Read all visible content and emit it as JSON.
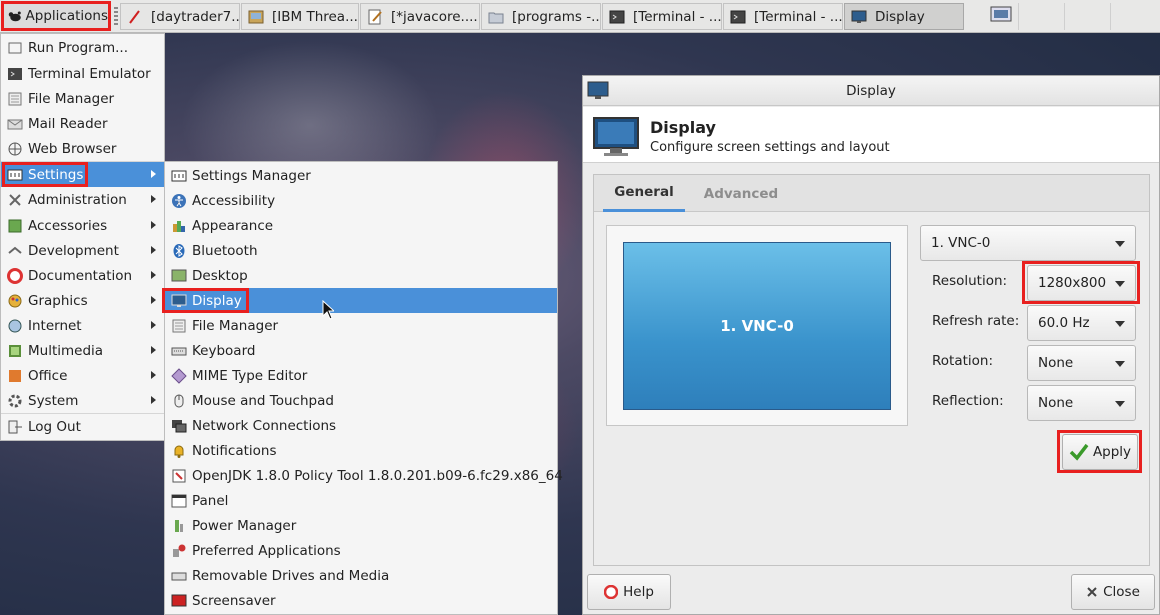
{
  "panel": {
    "app_menu_label": "Applications",
    "tasks": [
      {
        "label": "[daytrader7...",
        "icon": "pen-icon"
      },
      {
        "label": "[IBM Threa...",
        "icon": "java-app-icon"
      },
      {
        "label": "[*javacore....",
        "icon": "text-editor-icon"
      },
      {
        "label": "[programs -...",
        "icon": "folder-icon"
      },
      {
        "label": "[Terminal - ...",
        "icon": "terminal-icon"
      },
      {
        "label": "[Terminal - ...",
        "icon": "terminal-icon"
      },
      {
        "label": "Display",
        "icon": "display-icon"
      }
    ]
  },
  "apps_menu": {
    "items": [
      {
        "label": "Run Program...",
        "icon": "run-icon"
      },
      {
        "label": "Terminal Emulator",
        "icon": "terminal-icon"
      },
      {
        "label": "File Manager",
        "icon": "file-manager-icon"
      },
      {
        "label": "Mail Reader",
        "icon": "mail-icon"
      },
      {
        "label": "Web Browser",
        "icon": "globe-icon"
      },
      {
        "label": "Settings",
        "icon": "settings-icon"
      },
      {
        "label": "Administration",
        "icon": "tools-icon"
      },
      {
        "label": "Accessories",
        "icon": "accessories-icon"
      },
      {
        "label": "Development",
        "icon": "development-icon"
      },
      {
        "label": "Documentation",
        "icon": "help-icon"
      },
      {
        "label": "Graphics",
        "icon": "graphics-icon"
      },
      {
        "label": "Internet",
        "icon": "globe-icon"
      },
      {
        "label": "Multimedia",
        "icon": "multimedia-icon"
      },
      {
        "label": "Office",
        "icon": "office-icon"
      },
      {
        "label": "System",
        "icon": "gear-icon"
      },
      {
        "label": "Log Out",
        "icon": "logout-icon"
      }
    ]
  },
  "settings_menu": {
    "items": [
      {
        "label": "Settings Manager",
        "icon": "settings-manager-icon"
      },
      {
        "label": "Accessibility",
        "icon": "accessibility-icon"
      },
      {
        "label": "Appearance",
        "icon": "appearance-icon"
      },
      {
        "label": "Bluetooth",
        "icon": "bluetooth-icon"
      },
      {
        "label": "Desktop",
        "icon": "desktop-icon"
      },
      {
        "label": "Display",
        "icon": "display-icon"
      },
      {
        "label": "File Manager",
        "icon": "file-manager-icon"
      },
      {
        "label": "Keyboard",
        "icon": "keyboard-icon"
      },
      {
        "label": "MIME Type Editor",
        "icon": "mime-icon"
      },
      {
        "label": "Mouse and Touchpad",
        "icon": "mouse-icon"
      },
      {
        "label": "Network Connections",
        "icon": "network-icon"
      },
      {
        "label": "Notifications",
        "icon": "bell-icon"
      },
      {
        "label": "OpenJDK 1.8.0 Policy Tool 1.8.0.201.b09-6.fc29.x86_64",
        "icon": "java-icon"
      },
      {
        "label": "Panel",
        "icon": "panel-icon"
      },
      {
        "label": "Power Manager",
        "icon": "power-icon"
      },
      {
        "label": "Preferred Applications",
        "icon": "preferred-apps-icon"
      },
      {
        "label": "Removable Drives and Media",
        "icon": "drive-icon"
      },
      {
        "label": "Screensaver",
        "icon": "screensaver-icon"
      }
    ]
  },
  "dialog": {
    "window_title": "Display",
    "header_title": "Display",
    "header_subtitle": "Configure screen settings and layout",
    "tabs": [
      "General",
      "Advanced"
    ],
    "monitor_label": "1. VNC-0",
    "display_select": "1. VNC-0",
    "resolution_label": "Resolution:",
    "resolution_value": "1280x800",
    "refresh_label": "Refresh rate:",
    "refresh_value": "60.0 Hz",
    "rotation_label": "Rotation:",
    "rotation_value": "None",
    "reflection_label": "Reflection:",
    "reflection_value": "None",
    "apply_label": "Apply",
    "help_label": "Help",
    "close_label": "Close"
  },
  "colors": {
    "highlight": "#4a90d9",
    "annotation_red": "#e8201f",
    "monitor_blue": "#3a93cc"
  }
}
